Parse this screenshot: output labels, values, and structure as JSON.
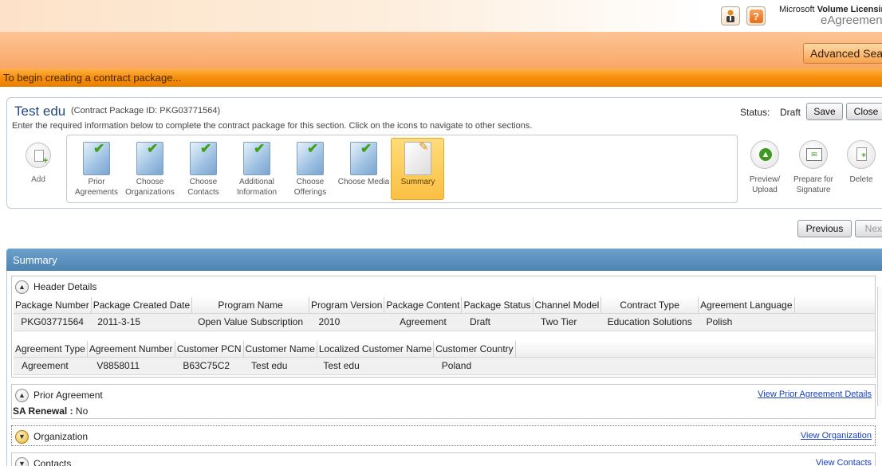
{
  "header": {
    "brand_line1": "Microsoft",
    "brand_line1_bold": "Volume Licensing",
    "brand_line2": "eAgreements",
    "user_icon": "user-badge-icon",
    "help_icon": "help-icon",
    "help_glyph": "?",
    "advanced_search": "Advanced Search"
  },
  "banner": {
    "text": "To begin creating a contract package..."
  },
  "package": {
    "title": "Test edu",
    "id_text": "(Contract Package ID: PKG03771564)",
    "instructions": "Enter the required information below to complete the contract package for this section. Click on the icons to navigate to other sections.",
    "status_label": "Status:",
    "status_value": "Draft",
    "save": "Save",
    "close": "Close",
    "add": "Add",
    "steps": [
      {
        "line1": "Prior",
        "line2": "Agreements"
      },
      {
        "line1": "Choose",
        "line2": "Organizations"
      },
      {
        "line1": "Choose",
        "line2": "Contacts"
      },
      {
        "line1": "Additional",
        "line2": "Information"
      },
      {
        "line1": "Choose",
        "line2": "Offerings"
      },
      {
        "line1": "Choose Media",
        "line2": ""
      },
      {
        "line1": "Summary",
        "line2": ""
      }
    ],
    "actions": [
      {
        "line1": "Preview/",
        "line2": "Upload"
      },
      {
        "line1": "Prepare for",
        "line2": "Signature"
      },
      {
        "line1": "Delete",
        "line2": ""
      }
    ],
    "previous": "Previous",
    "next": "Next"
  },
  "summary": {
    "title": "Summary",
    "header_details": {
      "title": "Header Details",
      "table1": {
        "headers": [
          "Package Number",
          "Package Created Date",
          "Program Name",
          "Program Version",
          "Package Content",
          "Package Status",
          "Channel Model",
          "Contract Type",
          "Agreement Language"
        ],
        "row": [
          "PKG03771564",
          "2011-3-15",
          "Open Value Subscription",
          "2010",
          "Agreement",
          "Draft",
          "Two Tier",
          "Education Solutions",
          "Polish"
        ]
      },
      "table2": {
        "headers": [
          "Agreement Type",
          "Agreement Number",
          "Customer PCN",
          "Customer Name",
          "Localized Customer Name",
          "Customer Country"
        ],
        "row": [
          "Agreement",
          "V8858011",
          "B63C75C2",
          "Test edu",
          "Test edu",
          "Poland"
        ]
      }
    },
    "prior_agreement": {
      "title": "Prior Agreement",
      "link": "View Prior Agreement Details",
      "sa_label": "SA Renewal :",
      "sa_value": "No"
    },
    "organization": {
      "title": "Organization",
      "link": "View Organization"
    },
    "contacts": {
      "title": "Contacts",
      "link": "View Contacts"
    }
  }
}
